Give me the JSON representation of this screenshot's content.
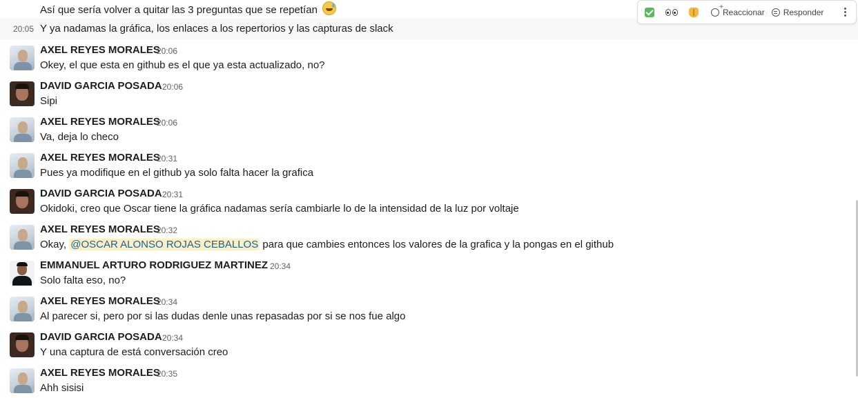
{
  "top_message": {
    "text": "Así que sería volver a quitar las 3 preguntas que se repetían"
  },
  "hover_message": {
    "time": "20:05",
    "text": "Y ya nadamas la gráfica, los enlaces a los repertorios y las capturas de slack"
  },
  "toolbar": {
    "emoji1": "white-check-mark",
    "emoji2": "eyes",
    "emoji3": "raised-hands",
    "react_label": "Reaccionar",
    "reply_label": "Responder"
  },
  "messages": [
    {
      "author": "AXEL REYES MORALES",
      "time": "20:06",
      "text": "Okey, el que esta en github es el que ya esta actualizado, no?"
    },
    {
      "author": "DAVID GARCIA POSADA",
      "time": "20:06",
      "text": "Sipi"
    },
    {
      "author": "AXEL REYES MORALES",
      "time": "20:06",
      "text": "Va, deja lo checo"
    },
    {
      "author": "AXEL REYES MORALES",
      "time": "20:31",
      "text": "Pues ya modifique en el github ya solo falta hacer la grafica"
    },
    {
      "author": "DAVID GARCIA POSADA",
      "time": "20:31",
      "text": "Okidoki, creo que Oscar tiene la gráfica nadamas sería cambiarle lo de la intensidad de la luz por voltaje"
    },
    {
      "author": "AXEL REYES MORALES",
      "time": "20:32",
      "pre": "Okay,",
      "mention": "@OSCAR ALONSO ROJAS CEBALLOS",
      "post": "para que cambies entonces los valores de la grafica y la pongas en el github"
    },
    {
      "author": "EMMANUEL ARTURO RODRIGUEZ MARTINEZ",
      "time": "20:34",
      "text": "Solo falta eso, no?"
    },
    {
      "author": "AXEL REYES MORALES",
      "time": "20:34",
      "text": "Al parecer si, pero por si las dudas denle unas repasadas por si se nos fue algo"
    },
    {
      "author": "DAVID GARCIA POSADA",
      "time": "20:34",
      "text": "Y una captura de está conversación creo"
    },
    {
      "author": "AXEL REYES MORALES",
      "time": "20:35",
      "text": "Ahh sisisi"
    }
  ]
}
